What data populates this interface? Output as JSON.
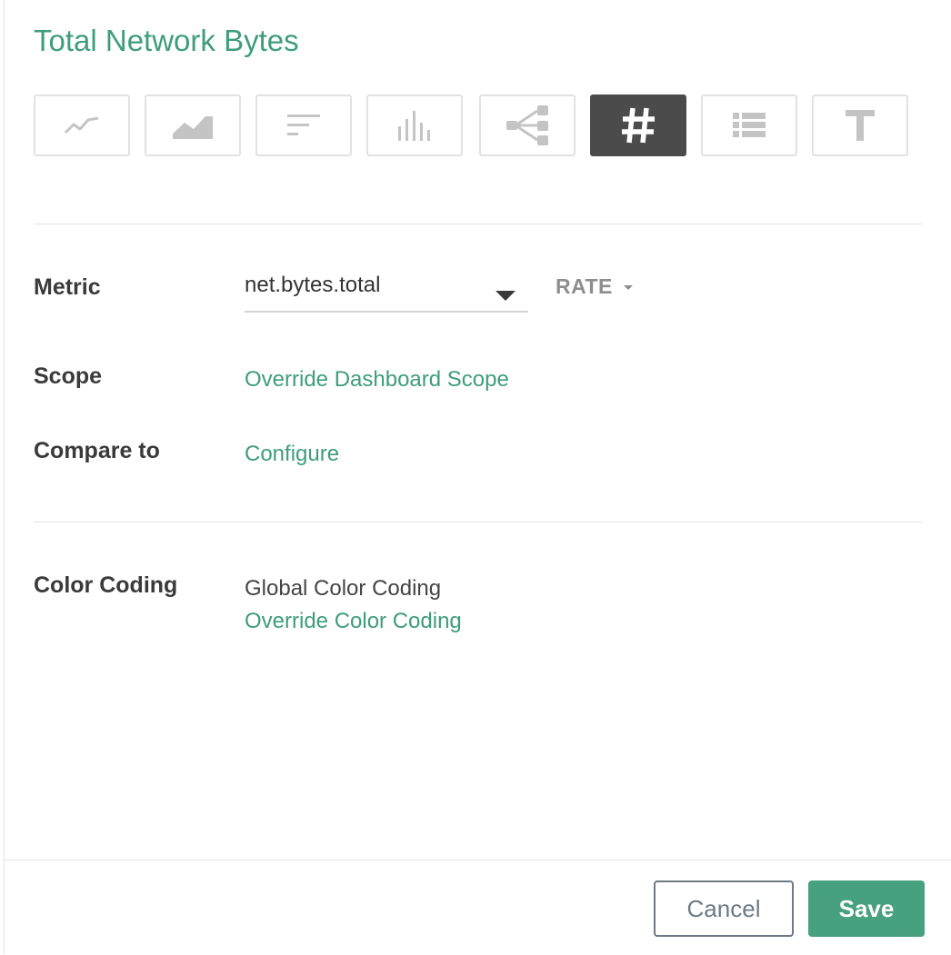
{
  "dialog": {
    "title": "Total Network Bytes"
  },
  "viz_types": [
    {
      "name": "line-chart-icon",
      "active": false
    },
    {
      "name": "area-chart-icon",
      "active": false
    },
    {
      "name": "bar-list-icon",
      "active": false
    },
    {
      "name": "histogram-icon",
      "active": false
    },
    {
      "name": "topology-icon",
      "active": false
    },
    {
      "name": "number-icon",
      "active": true
    },
    {
      "name": "list-icon",
      "active": false
    },
    {
      "name": "text-icon",
      "active": false
    }
  ],
  "form": {
    "metric_label": "Metric",
    "metric_value": "net.bytes.total",
    "rate_label": "RATE",
    "scope_label": "Scope",
    "scope_link": "Override Dashboard Scope",
    "compare_label": "Compare to",
    "compare_link": "Configure",
    "color_label": "Color Coding",
    "color_value": "Global Color Coding",
    "color_link": "Override Color Coding"
  },
  "footer": {
    "cancel_label": "Cancel",
    "save_label": "Save"
  },
  "colors": {
    "accent": "#3e9d7c",
    "save_bg": "#47a07e",
    "active_viz_bg": "#4b4b4b",
    "icon_gray": "#c4c4c4"
  }
}
